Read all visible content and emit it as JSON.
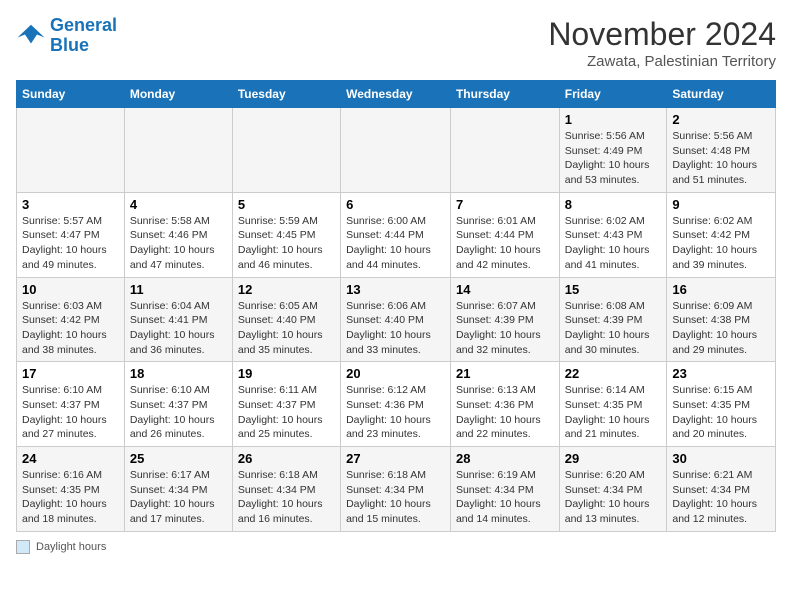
{
  "logo": {
    "line1": "General",
    "line2": "Blue"
  },
  "title": "November 2024",
  "subtitle": "Zawata, Palestinian Territory",
  "days_of_week": [
    "Sunday",
    "Monday",
    "Tuesday",
    "Wednesday",
    "Thursday",
    "Friday",
    "Saturday"
  ],
  "footer_label": "Daylight hours",
  "weeks": [
    [
      {
        "day": "",
        "info": ""
      },
      {
        "day": "",
        "info": ""
      },
      {
        "day": "",
        "info": ""
      },
      {
        "day": "",
        "info": ""
      },
      {
        "day": "",
        "info": ""
      },
      {
        "day": "1",
        "info": "Sunrise: 5:56 AM\nSunset: 4:49 PM\nDaylight: 10 hours and 53 minutes."
      },
      {
        "day": "2",
        "info": "Sunrise: 5:56 AM\nSunset: 4:48 PM\nDaylight: 10 hours and 51 minutes."
      }
    ],
    [
      {
        "day": "3",
        "info": "Sunrise: 5:57 AM\nSunset: 4:47 PM\nDaylight: 10 hours and 49 minutes."
      },
      {
        "day": "4",
        "info": "Sunrise: 5:58 AM\nSunset: 4:46 PM\nDaylight: 10 hours and 47 minutes."
      },
      {
        "day": "5",
        "info": "Sunrise: 5:59 AM\nSunset: 4:45 PM\nDaylight: 10 hours and 46 minutes."
      },
      {
        "day": "6",
        "info": "Sunrise: 6:00 AM\nSunset: 4:44 PM\nDaylight: 10 hours and 44 minutes."
      },
      {
        "day": "7",
        "info": "Sunrise: 6:01 AM\nSunset: 4:44 PM\nDaylight: 10 hours and 42 minutes."
      },
      {
        "day": "8",
        "info": "Sunrise: 6:02 AM\nSunset: 4:43 PM\nDaylight: 10 hours and 41 minutes."
      },
      {
        "day": "9",
        "info": "Sunrise: 6:02 AM\nSunset: 4:42 PM\nDaylight: 10 hours and 39 minutes."
      }
    ],
    [
      {
        "day": "10",
        "info": "Sunrise: 6:03 AM\nSunset: 4:42 PM\nDaylight: 10 hours and 38 minutes."
      },
      {
        "day": "11",
        "info": "Sunrise: 6:04 AM\nSunset: 4:41 PM\nDaylight: 10 hours and 36 minutes."
      },
      {
        "day": "12",
        "info": "Sunrise: 6:05 AM\nSunset: 4:40 PM\nDaylight: 10 hours and 35 minutes."
      },
      {
        "day": "13",
        "info": "Sunrise: 6:06 AM\nSunset: 4:40 PM\nDaylight: 10 hours and 33 minutes."
      },
      {
        "day": "14",
        "info": "Sunrise: 6:07 AM\nSunset: 4:39 PM\nDaylight: 10 hours and 32 minutes."
      },
      {
        "day": "15",
        "info": "Sunrise: 6:08 AM\nSunset: 4:39 PM\nDaylight: 10 hours and 30 minutes."
      },
      {
        "day": "16",
        "info": "Sunrise: 6:09 AM\nSunset: 4:38 PM\nDaylight: 10 hours and 29 minutes."
      }
    ],
    [
      {
        "day": "17",
        "info": "Sunrise: 6:10 AM\nSunset: 4:37 PM\nDaylight: 10 hours and 27 minutes."
      },
      {
        "day": "18",
        "info": "Sunrise: 6:10 AM\nSunset: 4:37 PM\nDaylight: 10 hours and 26 minutes."
      },
      {
        "day": "19",
        "info": "Sunrise: 6:11 AM\nSunset: 4:37 PM\nDaylight: 10 hours and 25 minutes."
      },
      {
        "day": "20",
        "info": "Sunrise: 6:12 AM\nSunset: 4:36 PM\nDaylight: 10 hours and 23 minutes."
      },
      {
        "day": "21",
        "info": "Sunrise: 6:13 AM\nSunset: 4:36 PM\nDaylight: 10 hours and 22 minutes."
      },
      {
        "day": "22",
        "info": "Sunrise: 6:14 AM\nSunset: 4:35 PM\nDaylight: 10 hours and 21 minutes."
      },
      {
        "day": "23",
        "info": "Sunrise: 6:15 AM\nSunset: 4:35 PM\nDaylight: 10 hours and 20 minutes."
      }
    ],
    [
      {
        "day": "24",
        "info": "Sunrise: 6:16 AM\nSunset: 4:35 PM\nDaylight: 10 hours and 18 minutes."
      },
      {
        "day": "25",
        "info": "Sunrise: 6:17 AM\nSunset: 4:34 PM\nDaylight: 10 hours and 17 minutes."
      },
      {
        "day": "26",
        "info": "Sunrise: 6:18 AM\nSunset: 4:34 PM\nDaylight: 10 hours and 16 minutes."
      },
      {
        "day": "27",
        "info": "Sunrise: 6:18 AM\nSunset: 4:34 PM\nDaylight: 10 hours and 15 minutes."
      },
      {
        "day": "28",
        "info": "Sunrise: 6:19 AM\nSunset: 4:34 PM\nDaylight: 10 hours and 14 minutes."
      },
      {
        "day": "29",
        "info": "Sunrise: 6:20 AM\nSunset: 4:34 PM\nDaylight: 10 hours and 13 minutes."
      },
      {
        "day": "30",
        "info": "Sunrise: 6:21 AM\nSunset: 4:34 PM\nDaylight: 10 hours and 12 minutes."
      }
    ]
  ]
}
